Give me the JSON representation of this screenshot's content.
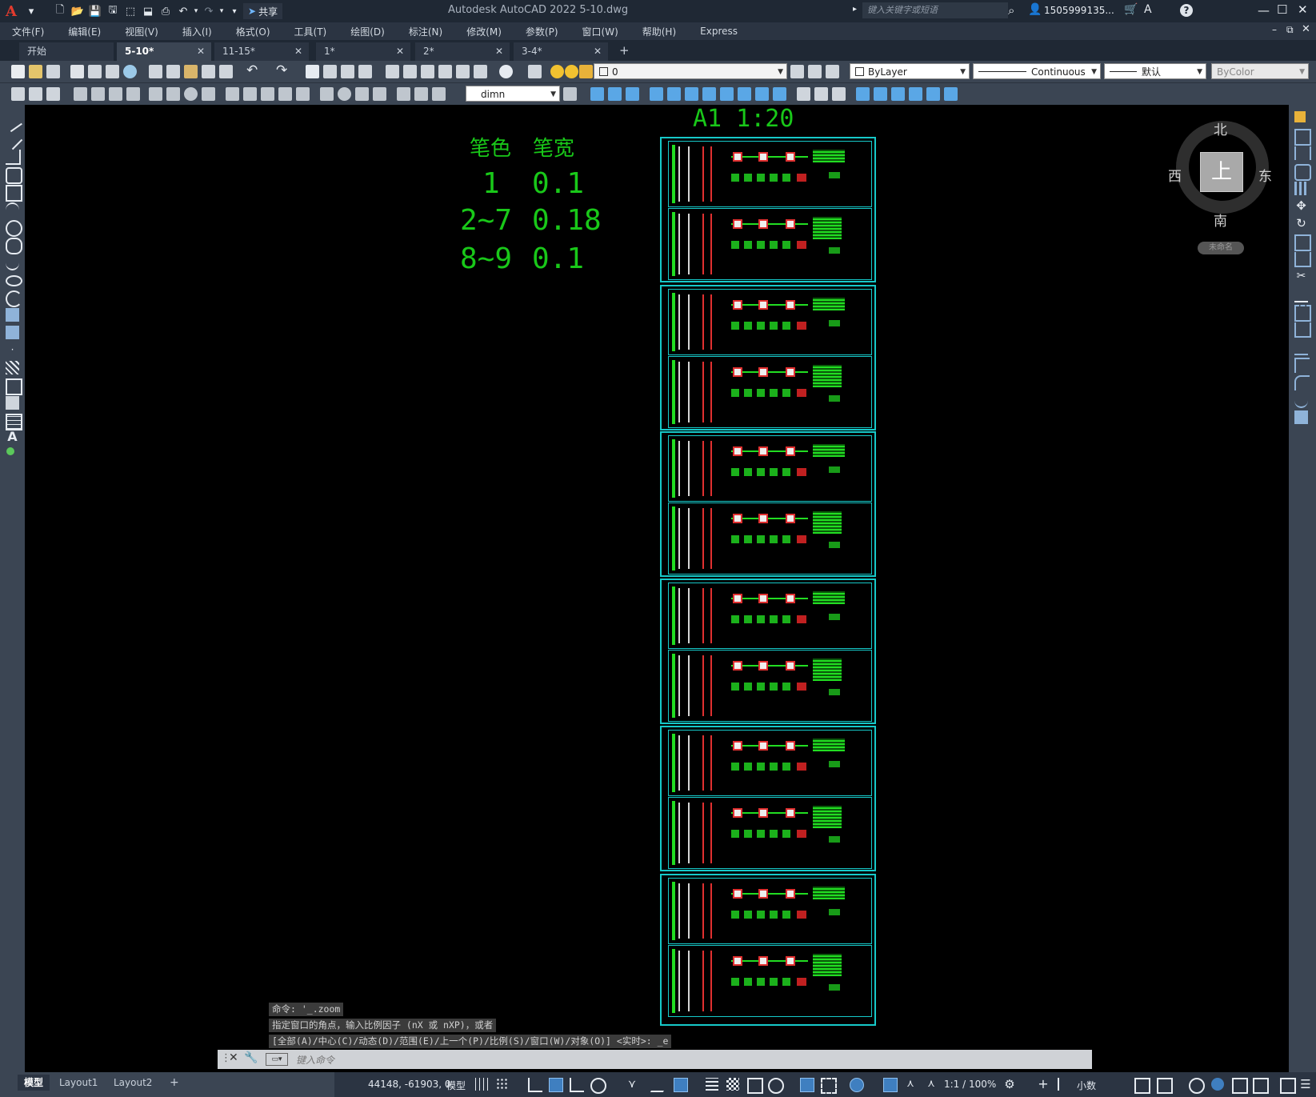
{
  "titlebar": {
    "logo": "A",
    "title": "Autodesk AutoCAD 2022    5-10.dwg",
    "share_label": "共享",
    "search_placeholder": "键入关键字或短语",
    "user": "1505999135...",
    "help": "?"
  },
  "menubar": {
    "items": [
      "文件(F)",
      "编辑(E)",
      "视图(V)",
      "插入(I)",
      "格式(O)",
      "工具(T)",
      "绘图(D)",
      "标注(N)",
      "修改(M)",
      "参数(P)",
      "窗口(W)",
      "帮助(H)",
      "Express"
    ]
  },
  "tabs": {
    "items": [
      {
        "label": "开始",
        "active": false,
        "closable": false
      },
      {
        "label": "5-10*",
        "active": true,
        "closable": true
      },
      {
        "label": "11-15*",
        "active": false,
        "closable": true
      },
      {
        "label": "1*",
        "active": false,
        "closable": true
      },
      {
        "label": "2*",
        "active": false,
        "closable": true
      },
      {
        "label": "3-4*",
        "active": false,
        "closable": true
      }
    ],
    "add_label": "+"
  },
  "properties": {
    "layer_value": "0",
    "color_value": "ByLayer",
    "linetype_value": "Continuous",
    "lineweight_value": "默认",
    "plotstyle_value": "ByColor",
    "dimstyle_value": "dimn"
  },
  "drawing": {
    "title": "A1  1:20",
    "table_headers": [
      "笔色",
      "笔宽"
    ],
    "table_rows": [
      [
        "1",
        "0.1"
      ],
      [
        "2~7",
        "0.18"
      ],
      [
        "8~9",
        "0.1"
      ]
    ]
  },
  "viewcube": {
    "north": "北",
    "south": "南",
    "east": "东",
    "west": "西",
    "face": "上",
    "wcs": "未命名"
  },
  "command": {
    "history": [
      "命令: '_.zoom",
      "指定窗口的角点，输入比例因子 (nX 或 nXP)，或者",
      "[全部(A)/中心(C)/动态(D)/范围(E)/上一个(P)/比例(S)/窗口(W)/对象(O)] <实时>: _e"
    ],
    "placeholder": "键入命令"
  },
  "layout_tabs": [
    "模型",
    "Layout1",
    "Layout2"
  ],
  "status": {
    "coords": "44148, -61903, 0",
    "space": "模型",
    "scale": "1:1 / 100%",
    "units": "小数"
  },
  "colors": {
    "drawing_green": "#19c819",
    "frame_cyan": "#16c9c9",
    "accent_red": "#e03030",
    "toolbar_bg": "#3b4553"
  }
}
